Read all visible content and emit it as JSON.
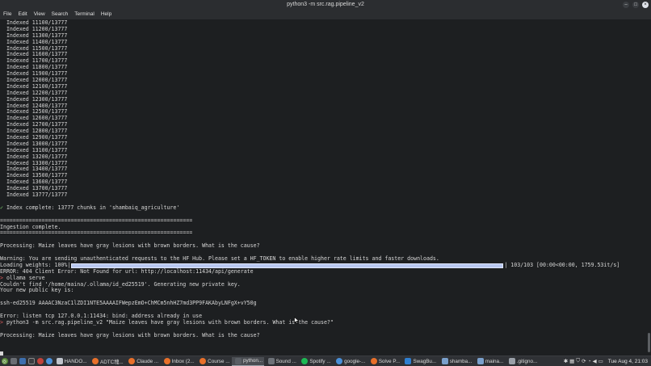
{
  "window": {
    "title": "python3 -m src.rag.pipeline_v2",
    "buttons": {
      "minimize": "–",
      "maximize": "□",
      "close": "×"
    }
  },
  "menu": [
    "File",
    "Edit",
    "View",
    "Search",
    "Terminal",
    "Help"
  ],
  "terminal": {
    "indexed_lines": [
      "  Indexed 11100/13777",
      "  Indexed 11200/13777",
      "  Indexed 11300/13777",
      "  Indexed 11400/13777",
      "  Indexed 11500/13777",
      "  Indexed 11600/13777",
      "  Indexed 11700/13777",
      "  Indexed 11800/13777",
      "  Indexed 11900/13777",
      "  Indexed 12000/13777",
      "  Indexed 12100/13777",
      "  Indexed 12200/13777",
      "  Indexed 12300/13777",
      "  Indexed 12400/13777",
      "  Indexed 12500/13777",
      "  Indexed 12600/13777",
      "  Indexed 12700/13777",
      "  Indexed 12800/13777",
      "  Indexed 12900/13777",
      "  Indexed 13000/13777",
      "  Indexed 13100/13777",
      "  Indexed 13200/13777",
      "  Indexed 13300/13777",
      "  Indexed 13400/13777",
      "  Indexed 13500/13777",
      "  Indexed 13600/13777",
      "  Indexed 13700/13777",
      "  Indexed 13777/13777"
    ],
    "index_complete_mark": "✓",
    "index_complete": " Index complete: 13777 chunks in 'shambaiq_agriculture'",
    "rule": "============================================================",
    "ingestion_complete": "Ingestion complete.",
    "processing_1": "Processing: Maize leaves have gray lesions with brown borders. What is the cause?",
    "warning": "Warning: You are sending unauthenticated requests to the HF Hub. Please set a HF_TOKEN to enable higher rate limits and faster downloads.",
    "loading_label": "Loading weights: 100%|",
    "loading_progress": 1.0,
    "loading_stats": "| 103/103 [00:00<00:00, 1759.53it/s]",
    "error_404": "ERROR: 404 Client Error: Not Found for url: http://localhost:11434/api/generate",
    "prompt_arrow": ">",
    "cmd_ollama": " ollama serve",
    "couldnt_find": "Couldn't find '/home/maina/.ollama/id_ed25519'. Generating new private key.",
    "public_key_label": "Your new public key is:",
    "public_key": "ssh-ed25519 AAAAC3NzaC1lZDI1NTE5AAAAIFWepzEmO+ChMCm5nhHZ7md3PP9FAKAbyLNFgX+vY50g",
    "error_listen": "Error: listen tcp 127.0.0.1:11434: bind: address already in use",
    "cmd_python": " python3 -m src.rag.pipeline_v2 \"Maize leaves have gray lesions with brown borders. What is the cause?\"",
    "processing_2": "Processing: Maize leaves have gray lesions with brown borders. What is the cause?"
  },
  "taskbar": {
    "tasks": [
      {
        "label": "HANDO...",
        "icon": "document-icon",
        "color": "#c0c4cc"
      },
      {
        "label": "ADTC塊...",
        "icon": "firefox-icon",
        "color": "#e8702a"
      },
      {
        "label": "Claude ...",
        "icon": "firefox-icon",
        "color": "#e8702a"
      },
      {
        "label": "Inbox (2...",
        "icon": "firefox-icon",
        "color": "#e8702a"
      },
      {
        "label": "Course ...",
        "icon": "firefox-icon",
        "color": "#e8702a"
      },
      {
        "label": "python...",
        "icon": "terminal-icon",
        "color": "#5a5e64"
      },
      {
        "label": "Sound ...",
        "icon": "sound-icon",
        "color": "#6d7278"
      },
      {
        "label": "Spotify ...",
        "icon": "spotify-icon",
        "color": "#1db954"
      },
      {
        "label": "google-...",
        "icon": "chrome-icon",
        "color": "#4a90d9"
      },
      {
        "label": "Solve P...",
        "icon": "firefox-icon",
        "color": "#e8702a"
      },
      {
        "label": "SwagBu...",
        "icon": "vscode-icon",
        "color": "#2f7fd1"
      },
      {
        "label": "shamba...",
        "icon": "folder-icon",
        "color": "#7aa0cc"
      },
      {
        "label": "maina...",
        "icon": "folder-icon",
        "color": "#7aa0cc"
      },
      {
        "label": ".gitigno...",
        "icon": "editor-icon",
        "color": "#9aa0a8"
      }
    ],
    "active_task": "python...",
    "clock": "Tue Aug 4, 21:03"
  }
}
